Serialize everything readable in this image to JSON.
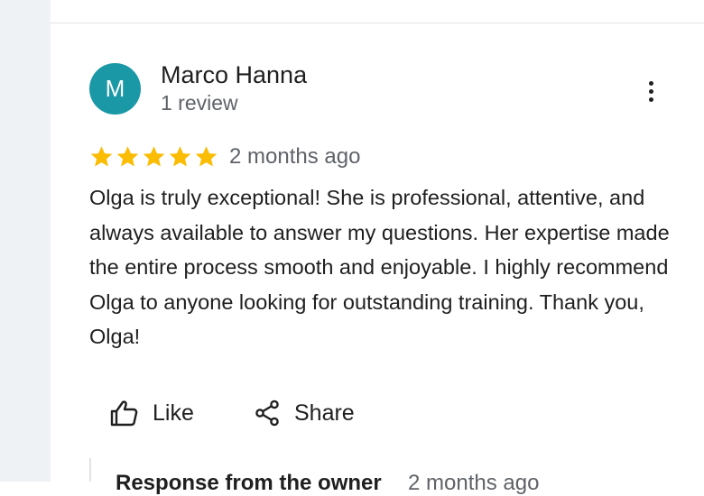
{
  "review": {
    "author": {
      "initial": "M",
      "name": "Marco Hanna",
      "review_count": "1 review",
      "avatar_color": "#1a98a6"
    },
    "rating": 5,
    "rating_max": 5,
    "star_color": "#fbbc04",
    "date": "2 months ago",
    "text": "Olga is truly exceptional! She is professional, attentive, and always available to answer my questions. Her expertise made the entire process smooth and enjoyable. I highly recommend Olga to anyone looking for outstanding training. Thank you, Olga!",
    "actions": {
      "like_label": "Like",
      "like_icon": "thumbs-up-icon",
      "share_label": "Share",
      "share_icon": "share-icon",
      "more_icon": "more-vert-icon"
    },
    "owner_response": {
      "title": "Response from the owner",
      "date": "2 months ago"
    }
  }
}
